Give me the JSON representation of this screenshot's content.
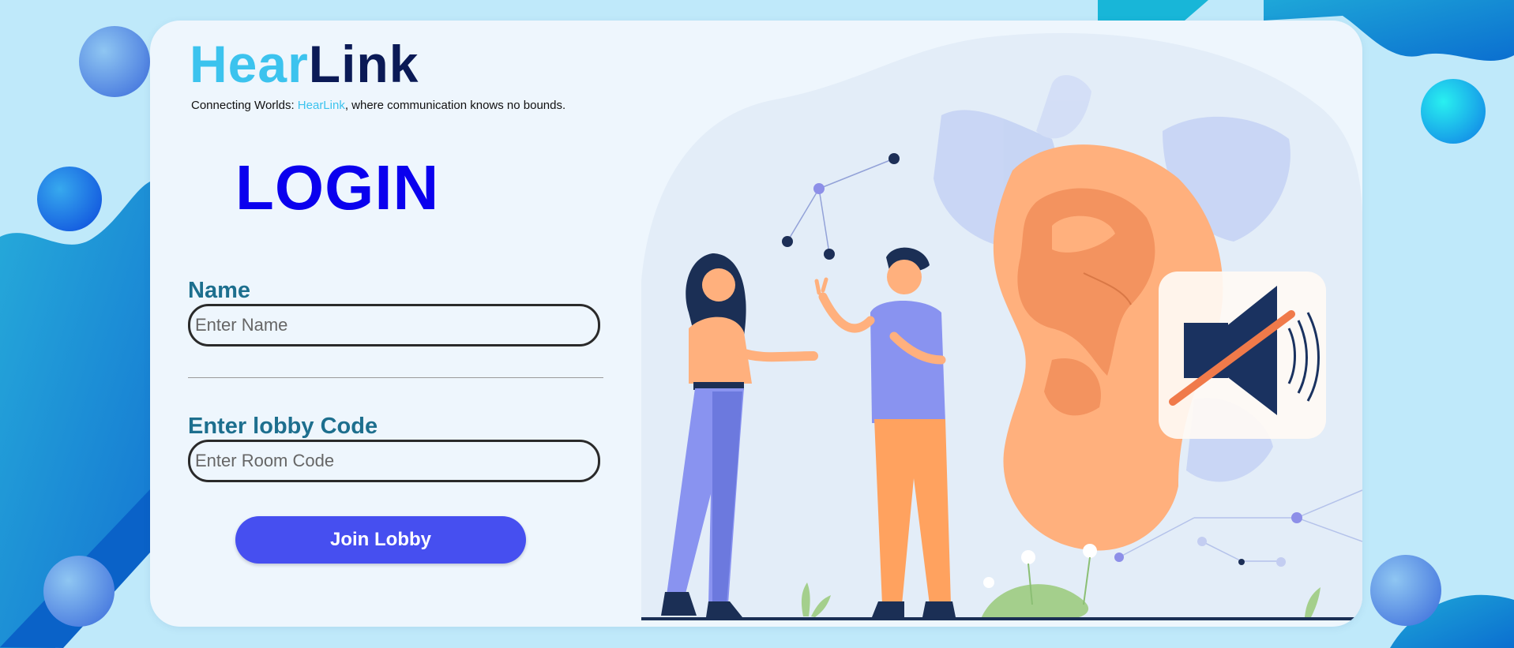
{
  "brand": {
    "hear": "Hear",
    "link": "Link"
  },
  "tagline": {
    "prefix": "Connecting Worlds: ",
    "brand": "HearLink",
    "suffix": ", where communication knows no bounds."
  },
  "login": {
    "title": "LOGIN",
    "name_label": "Name",
    "name_placeholder": "Enter Name",
    "name_value": "",
    "code_label": "Enter lobby Code",
    "code_placeholder": "Enter Room Code",
    "code_value": "",
    "join_label": "Join Lobby"
  },
  "illustration": {
    "icon": "muted-speaker-icon",
    "subject": "two-people-talking-beside-large-ear"
  },
  "colors": {
    "brand_light": "#3cc3ee",
    "brand_dark": "#0b1a56",
    "login_title": "#0a00ee",
    "label": "#1d6f8e",
    "button": "#464ff0",
    "page_bg": "#bfe9fa"
  }
}
